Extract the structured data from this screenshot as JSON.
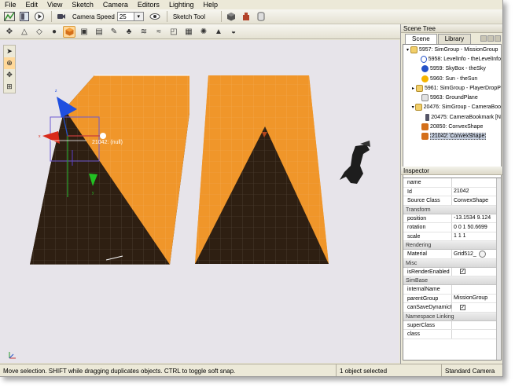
{
  "menu": [
    "File",
    "Edit",
    "View",
    "Sketch",
    "Camera",
    "Editors",
    "Lighting",
    "Help"
  ],
  "toolbar": {
    "camera_speed_label": "Camera Speed",
    "camera_speed_value": "25",
    "sketch_tool_label": "Sketch Tool"
  },
  "viewport": {
    "selection_label": "21042: (null)"
  },
  "scene_tree": {
    "title": "Scene Tree",
    "tabs": [
      "Scene",
      "Library"
    ],
    "items": [
      {
        "label": "5957: SimGroup - MissionGroup",
        "indent": 0,
        "expander": "▾",
        "icon": "folder-icon",
        "selected": false
      },
      {
        "label": "5958: LevelInfo - theLevelInfo",
        "indent": 2,
        "expander": "",
        "icon": "level-info-icon",
        "selected": false
      },
      {
        "label": "5959: SkyBox - theSky",
        "indent": 2,
        "expander": "",
        "icon": "skybox-icon",
        "selected": false
      },
      {
        "label": "5960: Sun - theSun",
        "indent": 2,
        "expander": "",
        "icon": "sun-icon",
        "selected": false
      },
      {
        "label": "5961: SimGroup - PlayerDropP",
        "indent": 1,
        "expander": "▸",
        "icon": "folder-icon",
        "selected": false
      },
      {
        "label": "5963: GroundPlane",
        "indent": 2,
        "expander": "",
        "icon": "ground-plane-icon",
        "selected": false
      },
      {
        "label": "20476: SimGroup - CameraBoo",
        "indent": 1,
        "expander": "▾",
        "icon": "folder-icon",
        "selected": false
      },
      {
        "label": "20475: CameraBookmark [N",
        "indent": 3,
        "expander": "",
        "icon": "camera-bookmark-icon",
        "selected": false
      },
      {
        "label": "20850: ConvexShape",
        "indent": 2,
        "expander": "",
        "icon": "convex-shape-icon",
        "selected": false
      },
      {
        "label": "21042: ConvexShape",
        "indent": 2,
        "expander": "",
        "icon": "convex-shape-icon",
        "selected": true
      }
    ]
  },
  "inspector": {
    "title": "Inspector",
    "sections": [
      {
        "type": "row",
        "key": "name",
        "value": ""
      },
      {
        "type": "row",
        "key": "Id",
        "value": "21042"
      },
      {
        "type": "row",
        "key": "Source Class",
        "value": "ConvexShape"
      },
      {
        "type": "group",
        "label": "Transform"
      },
      {
        "type": "row",
        "key": "position",
        "value": "-13.1534 9.124"
      },
      {
        "type": "row",
        "key": "rotation",
        "value": "0 0 1 50.6699"
      },
      {
        "type": "row",
        "key": "scale",
        "value": "1 1 1"
      },
      {
        "type": "group",
        "label": "Rendering"
      },
      {
        "type": "row",
        "key": "Material",
        "value": "Grid512_",
        "button": true
      },
      {
        "type": "group",
        "label": "Misc"
      },
      {
        "type": "row",
        "key": "isRenderEnabled",
        "value": "",
        "checkbox": true
      },
      {
        "type": "group",
        "label": "SimBase"
      },
      {
        "type": "row",
        "key": "internalName",
        "value": ""
      },
      {
        "type": "row",
        "key": "parentGroup",
        "value": "MissionGroup"
      },
      {
        "type": "row",
        "key": "canSaveDynamicF...",
        "value": "",
        "checkbox": true
      },
      {
        "type": "group",
        "label": "Namespace Linking"
      },
      {
        "type": "row",
        "key": "superClass",
        "value": ""
      },
      {
        "type": "row",
        "key": "class",
        "value": ""
      }
    ]
  },
  "status": {
    "hint": "Move selection.  SHIFT while dragging duplicates objects.  CTRL to toggle soft snap.",
    "selection_count": "1 object selected",
    "camera_mode": "Standard Camera"
  },
  "colors": {
    "shape_top": "#f0962a",
    "shape_dark": "#2e1f12",
    "viewport_bg": "#e7e4ea"
  }
}
